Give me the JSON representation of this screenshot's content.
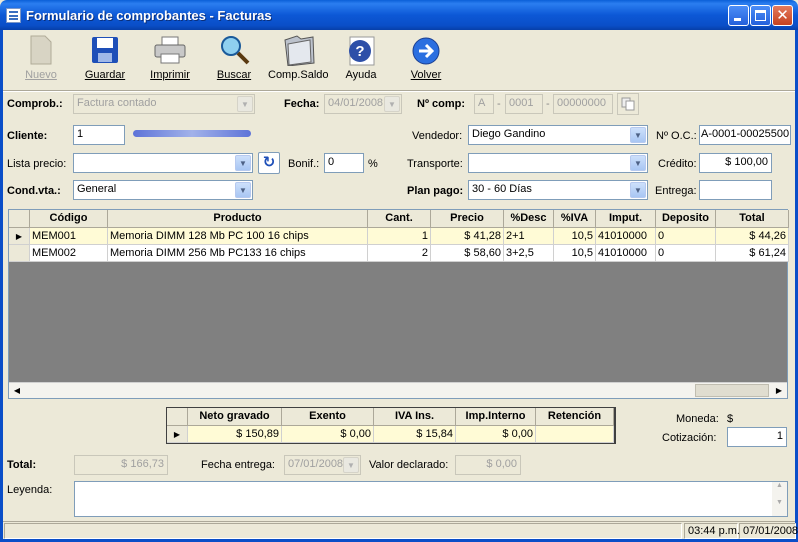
{
  "window": {
    "title": "Formulario de comprobantes - Facturas"
  },
  "toolbar": {
    "nuevo": "Nuevo",
    "guardar": "Guardar",
    "imprimir": "Imprimir",
    "buscar": "Buscar",
    "comp_saldo": "Comp.Saldo",
    "ayuda": "Ayuda",
    "volver": "Volver"
  },
  "form": {
    "comprob_label": "Comprob.:",
    "comprob_value": "Factura contado",
    "fecha_label": "Fecha:",
    "fecha_value": "04/01/2008",
    "ncomp_label": "Nº comp:",
    "ncomp_letter": "A",
    "ncomp_dash1": "-",
    "ncomp_pv": "0001",
    "ncomp_dash2": "-",
    "ncomp_num": "00000000",
    "cliente_label": "Cliente:",
    "cliente_value": "1",
    "vendedor_label": "Vendedor:",
    "vendedor_value": "Diego Gandino",
    "noc_label": "Nº O.C.:",
    "noc_value": "A-0001-00025500",
    "lista_label": "Lista precio:",
    "lista_value": "",
    "bonif_label": "Bonif.:",
    "bonif_value": "0",
    "bonif_unit": "%",
    "transporte_label": "Transporte:",
    "transporte_value": "",
    "credito_label": "Crédito:",
    "credito_value": "$ 100,00",
    "condvta_label": "Cond.vta.:",
    "condvta_value": "General",
    "planpago_label": "Plan pago:",
    "planpago_value": "30 - 60 Días",
    "entrega_label": "Entrega:",
    "entrega_value": ""
  },
  "items": {
    "headers": [
      "Código",
      "Producto",
      "Cant.",
      "Precio",
      "%Desc",
      "%IVA",
      "Imput.",
      "Deposito",
      "Total"
    ],
    "rows": [
      {
        "codigo": "MEM001",
        "producto": "Memoria DIMM 128 Mb PC 100 16 chips",
        "cant": "1",
        "precio": "$ 41,28",
        "desc": "2+1",
        "iva": "10,5",
        "imput": "41010000",
        "deposito": "0",
        "total": "$ 44,26"
      },
      {
        "codigo": "MEM002",
        "producto": "Memoria DIMM 256 Mb PC133 16 chips",
        "cant": "2",
        "precio": "$ 58,60",
        "desc": "3+2,5",
        "iva": "10,5",
        "imput": "41010000",
        "deposito": "0",
        "total": "$ 61,24"
      }
    ]
  },
  "totals": {
    "headers": [
      "Neto gravado",
      "Exento",
      "IVA Ins.",
      "Imp.Interno",
      "Retención"
    ],
    "values": [
      "$ 150,89",
      "$ 0,00",
      "$ 15,84",
      "$ 0,00",
      ""
    ]
  },
  "moneda": {
    "label": "Moneda:",
    "value": "$",
    "cotizacion_label": "Cotización:",
    "cotizacion_value": "1"
  },
  "footer": {
    "total_label": "Total:",
    "total_value": "$ 166,73",
    "fecha_entrega_label": "Fecha entrega:",
    "fecha_entrega_value": "07/01/2008",
    "valor_label": "Valor declarado:",
    "valor_value": "$ 0,00",
    "leyenda_label": "Leyenda:"
  },
  "status": {
    "time": "03:44 p.m.",
    "date": "07/01/2008"
  }
}
